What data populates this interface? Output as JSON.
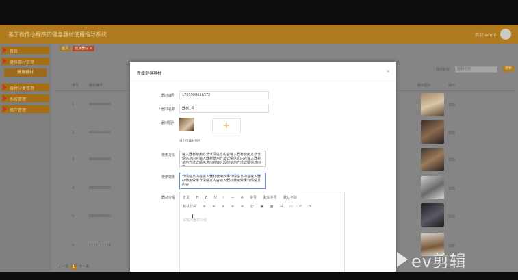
{
  "header": {
    "title": "基于微信小程序的健身器材使用指导系统",
    "user": "欢迎 admin"
  },
  "sidebar": {
    "items": [
      {
        "label": "首页"
      },
      {
        "label": "健身器材管理"
      },
      {
        "label": "健身器材"
      },
      {
        "label": "器材分类管理"
      },
      {
        "label": "系统管理"
      },
      {
        "label": "用户管理"
      }
    ]
  },
  "tabs": [
    {
      "label": "首页"
    },
    {
      "label": "健身器材 ×"
    }
  ],
  "search": {
    "label": "器材名称",
    "placeholder": "器材名称",
    "button": "搜索"
  },
  "table": {
    "headers": [
      "序号",
      "器材编号",
      "器材图片",
      "操作"
    ],
    "rows": [
      {
        "no": "1",
        "code": "0000000000",
        "name": "详情"
      },
      {
        "no": "2",
        "code": "0000000000",
        "name": "详情"
      },
      {
        "no": "3",
        "code": "0000000000",
        "name": "详情"
      },
      {
        "no": "4",
        "code": "0000000000",
        "name": "详情"
      },
      {
        "no": "5",
        "code": "0000000000",
        "name": "详情"
      },
      {
        "no": "6",
        "code": "1111111111",
        "name": "详情"
      }
    ]
  },
  "pager": {
    "prev": "上一页",
    "current": "1",
    "next": "下一页"
  },
  "modal": {
    "title": "新增健身器材",
    "close": "×",
    "fields": {
      "code_label": "器材编号",
      "code_value": "1705568616372",
      "name_label": "* 器材名称",
      "name_value": "器材1号",
      "image_label": "器材图片",
      "upload_hint": "请上传器材图片",
      "usage_label": "使用方法",
      "usage_value": "输入器材使用方法详情信息内容输入器材使用方法详情信息内容输入器材使用方法详情信息内容输入器材使用方法详情信息内容输入器材使用方法详情信息内容",
      "effect_label": "使用效果",
      "effect_value": "详情信息内容输入器材使用效果详情信息内容输入器材使用效果详情信息内容输入器材使用效果详情信息内容",
      "intro_label": "器材介绍",
      "editor_placeholder": "请输入器材介绍"
    },
    "toolbar_row1": [
      "正文",
      "H",
      "B",
      "U",
      "I",
      "—",
      "A",
      "字号",
      "默认字号",
      "默认字体"
    ],
    "toolbar_row2": [
      "默认行高",
      "≡",
      "≡",
      "≡",
      "≡",
      "≡",
      "☺",
      "▣",
      "▦",
      "↔",
      "▭",
      "↶",
      "↷"
    ]
  },
  "watermark": {
    "text": "ev剪辑"
  }
}
